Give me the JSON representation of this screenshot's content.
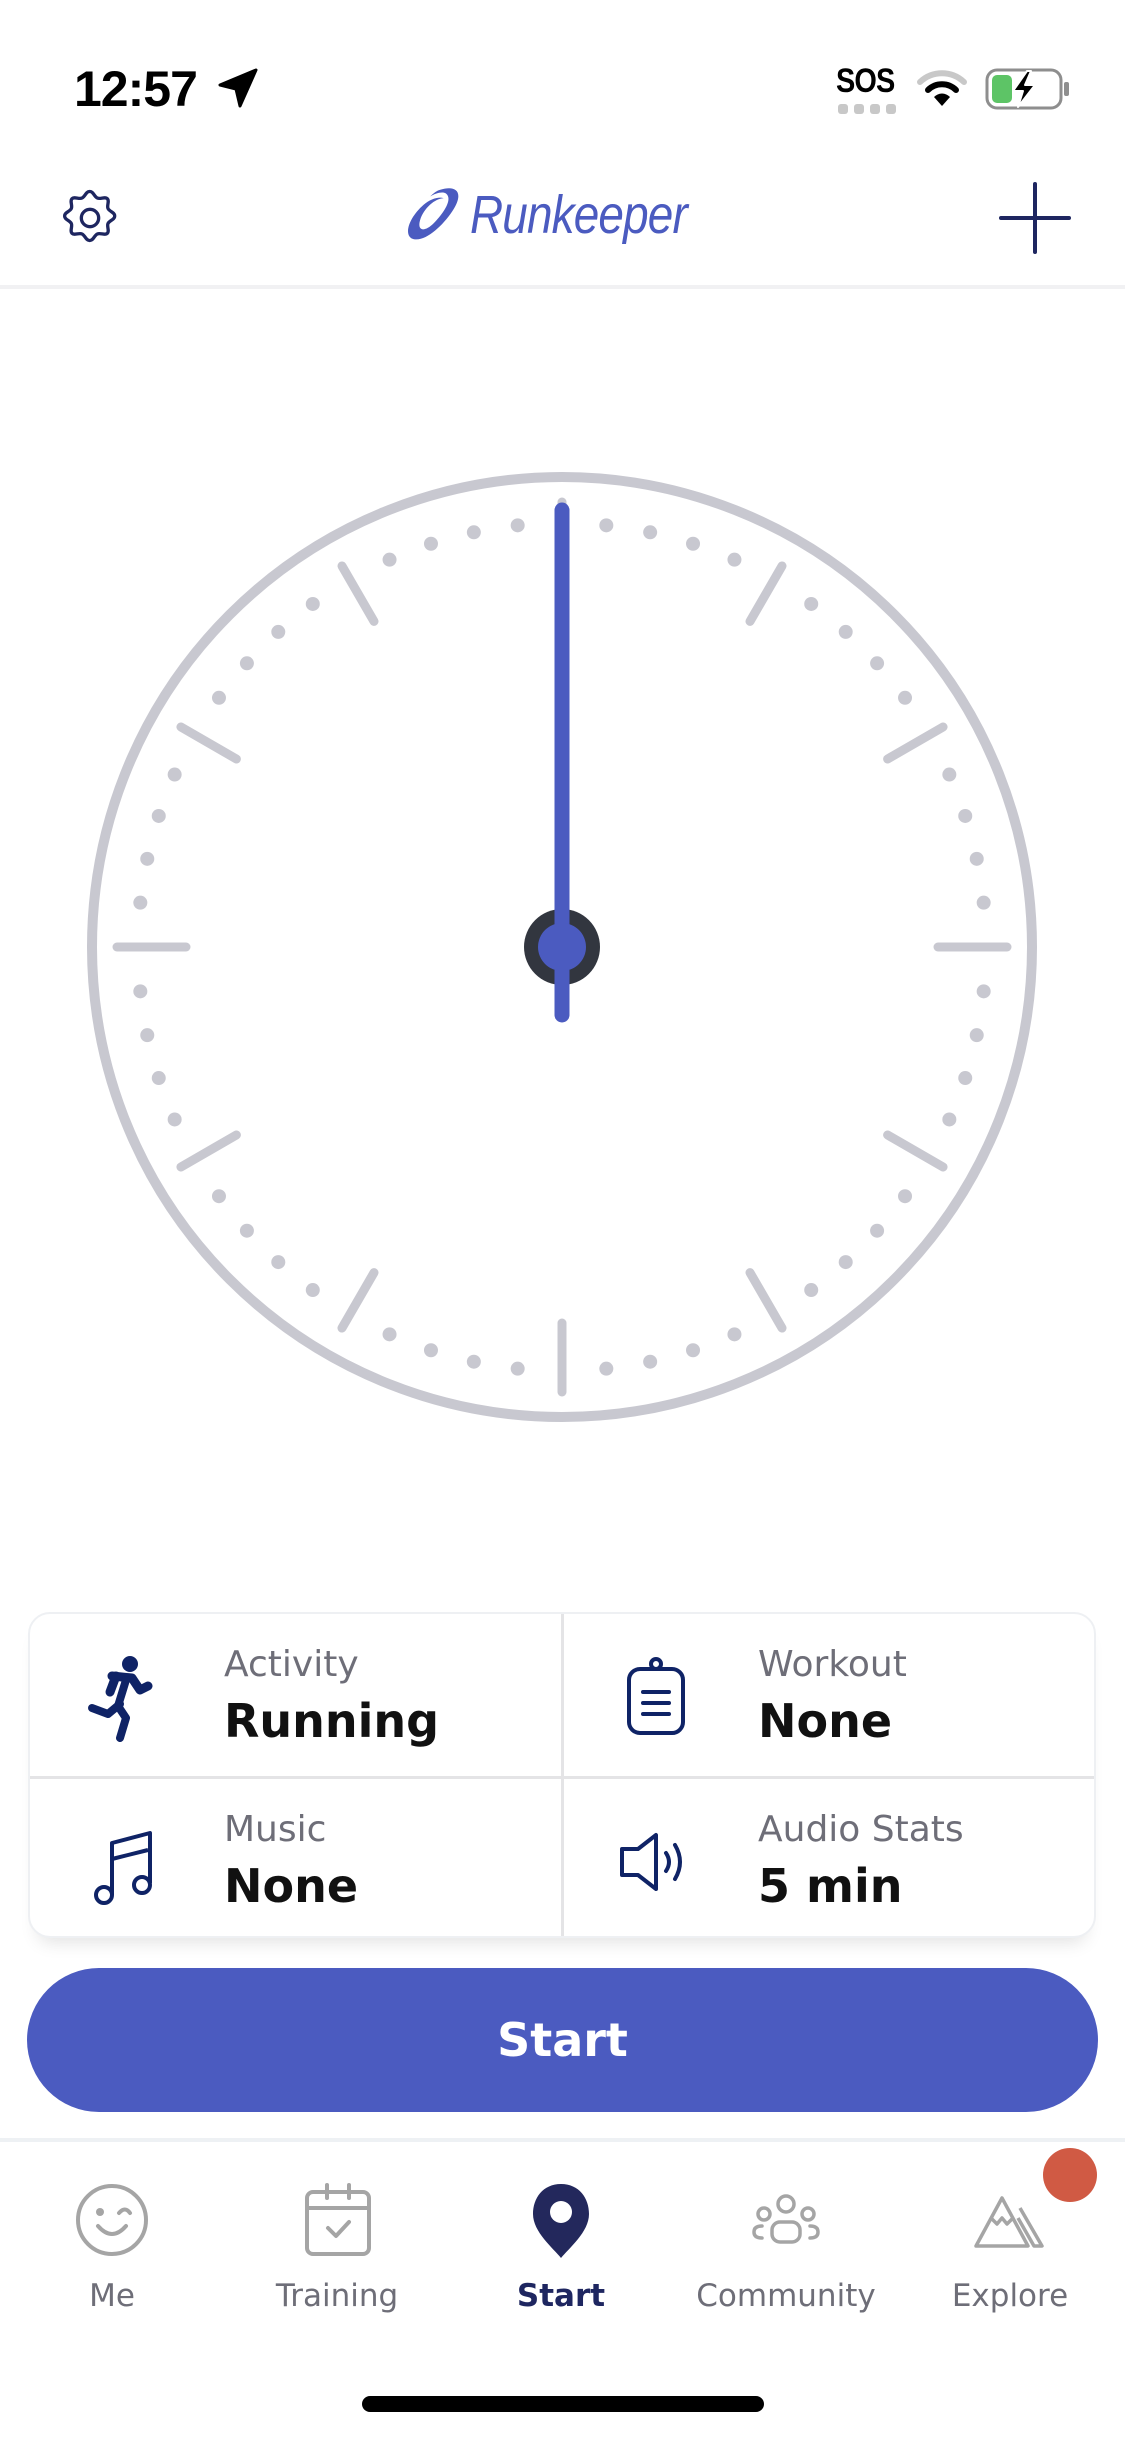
{
  "status_bar": {
    "time": "12:57",
    "location_icon": "location-arrow-icon",
    "carrier_text": "SOS",
    "wifi_icon": "wifi-icon",
    "battery_icon": "battery-charging-icon"
  },
  "header": {
    "settings_icon": "gear-icon",
    "logo_text": "Runkeeper",
    "add_icon": "plus-icon"
  },
  "clock": {
    "hand_position_seconds": 0,
    "ring_color": "#c8c8d0",
    "hand_color": "#4b5bc0",
    "hub_color": "#32363f"
  },
  "settings_card": {
    "cells": [
      {
        "label": "Activity",
        "value": "Running",
        "icon": "running-icon"
      },
      {
        "label": "Workout",
        "value": "None",
        "icon": "clipboard-icon"
      },
      {
        "label": "Music",
        "value": "None",
        "icon": "music-note-icon"
      },
      {
        "label": "Audio Stats",
        "value": "5 min",
        "icon": "speaker-icon"
      }
    ]
  },
  "start_button": {
    "label": "Start",
    "color": "#4b5bc0"
  },
  "tabbar": {
    "tabs": [
      {
        "label": "Me",
        "icon": "wink-face-icon",
        "active": false
      },
      {
        "label": "Training",
        "icon": "calendar-check-icon",
        "active": false
      },
      {
        "label": "Start",
        "icon": "map-pin-icon",
        "active": true
      },
      {
        "label": "Community",
        "icon": "people-group-icon",
        "active": false
      },
      {
        "label": "Explore",
        "icon": "mountain-icon",
        "active": false,
        "has_notification": true
      }
    ],
    "active_color": "#1e2660",
    "inactive_color": "#a5a5a5",
    "notification_color": "#d05a44"
  }
}
